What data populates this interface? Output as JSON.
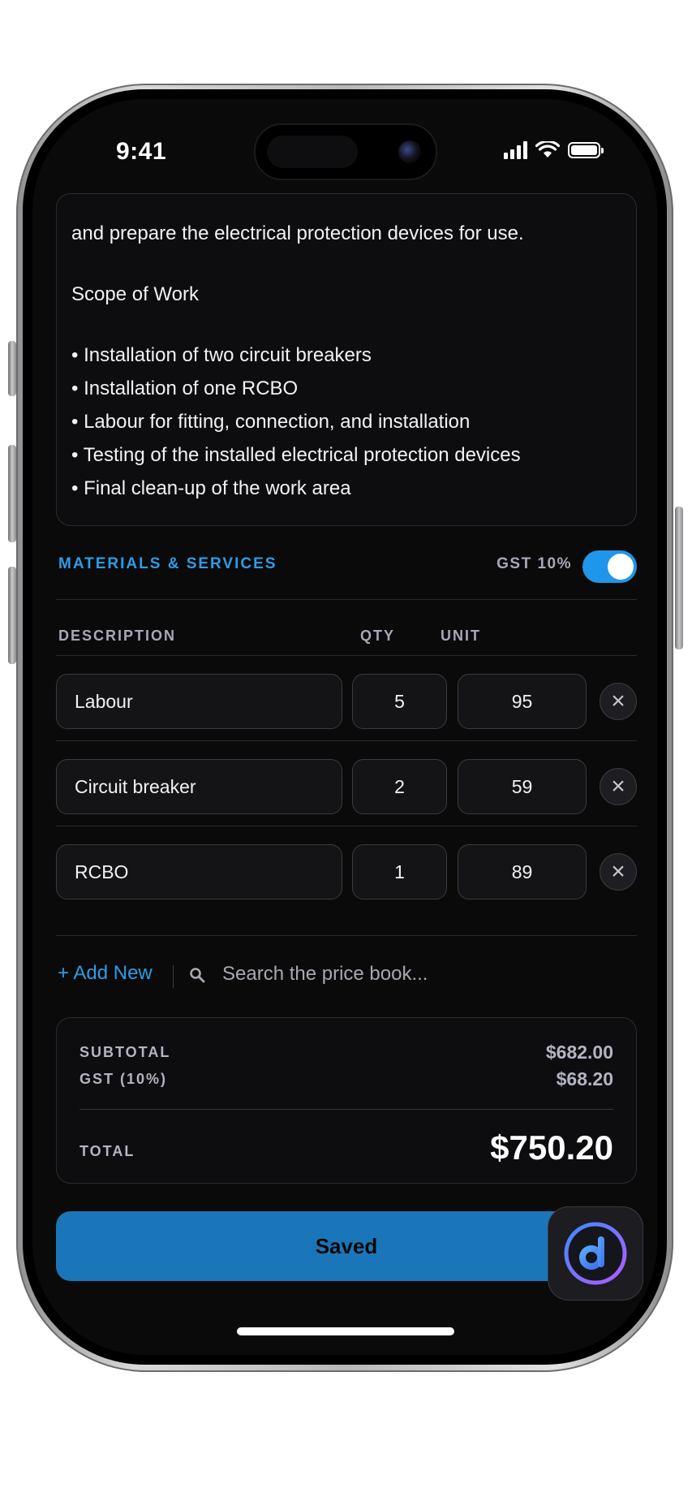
{
  "status_bar": {
    "time": "9:41"
  },
  "description": {
    "intro": "and prepare the electrical protection devices for use.",
    "scope_heading": "Scope of Work",
    "bullets": [
      "• Installation of two circuit breakers",
      "• Installation of one RCBO",
      "• Labour for fitting, connection, and installation",
      "• Testing of the installed electrical protection devices",
      "• Final clean-up of the work area"
    ]
  },
  "materials": {
    "title": "MATERIALS & SERVICES",
    "gst_label": "GST 10%",
    "gst_enabled": true,
    "columns": {
      "description": "DESCRIPTION",
      "qty": "QTY",
      "unit": "UNIT"
    },
    "items": [
      {
        "description": "Labour",
        "qty": "5",
        "unit": "95"
      },
      {
        "description": "Circuit breaker",
        "qty": "2",
        "unit": "59"
      },
      {
        "description": "RCBO",
        "qty": "1",
        "unit": "89"
      }
    ],
    "remove_glyph": "×",
    "add_new_label": "+ Add New",
    "search_placeholder": "Search the price book..."
  },
  "totals": {
    "subtotal_label": "SUBTOTAL",
    "subtotal_value": "$682.00",
    "gst_label": "GST (10%)",
    "gst_value": "$68.20",
    "total_label": "TOTAL",
    "total_value": "$750.20"
  },
  "actions": {
    "saved_label": "Saved"
  },
  "colors": {
    "accent": "#2e9ce6",
    "button": "#1b76b9",
    "background": "#0a0a0b"
  }
}
